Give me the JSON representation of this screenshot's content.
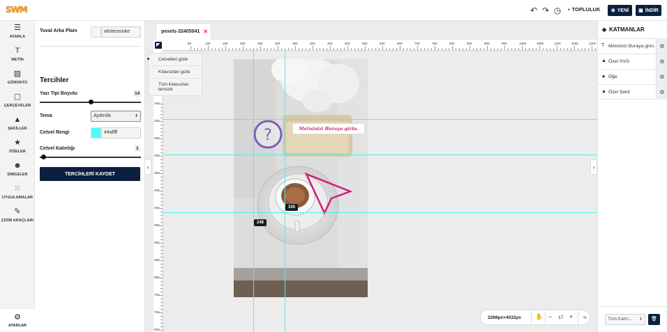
{
  "app": {
    "logo": "SWM"
  },
  "topbar": {
    "community_label": "TOPLULUK",
    "new_label": "YENİ",
    "download_label": "İNDİR"
  },
  "sidebar": {
    "items": [
      {
        "label": "AYARLA",
        "icon": "sliders-icon"
      },
      {
        "label": "METİN",
        "icon": "text-icon"
      },
      {
        "label": "GÖRÜNTÜ",
        "icon": "image-icon"
      },
      {
        "label": "ÇERÇEVELER",
        "icon": "frame-icon"
      },
      {
        "label": "ŞEKİLLER",
        "icon": "shapes-icon"
      },
      {
        "label": "ÖĞELER",
        "icon": "star-icon"
      },
      {
        "label": "SİMGELER",
        "icon": "emoji-icon"
      },
      {
        "label": "UYGULAMALAR",
        "icon": "grid-icon"
      },
      {
        "label": "ÇİZİM ARAÇLARI",
        "icon": "brush-icon"
      }
    ],
    "settings_label": "AYARLAR"
  },
  "settings": {
    "canvas_bg_label": "Tuval Arka Planı",
    "canvas_bg_value": "whitesmoke",
    "prefs_title": "Tercihler",
    "font_size_label": "Yazı Tipi Boyutu",
    "font_size_value": "14",
    "font_size_fraction": 0.5,
    "theme_label": "Tema",
    "theme_value": "Aydınlık",
    "ruler_color_label": "Cetvel Rengi",
    "ruler_color_value": "#4affff",
    "ruler_width_label": "Cetvel Kalınlığı",
    "ruler_width_value": "1",
    "ruler_width_fraction": 0.0,
    "save_label": "TERCİHLERİ KAYDET"
  },
  "workspace": {
    "tab_name": "pexels-32405041",
    "ruler_h_ticks": [
      "50",
      "100",
      "150",
      "200",
      "250",
      "300",
      "350",
      "400",
      "450",
      "500",
      "550",
      "600",
      "650",
      "700",
      "750",
      "800",
      "850",
      "900",
      "950",
      "1000",
      "1050",
      "1100",
      "1150",
      "1200"
    ],
    "ruler_v_ticks": [
      "150",
      "200",
      "250",
      "300",
      "350",
      "400",
      "450",
      "500",
      "550",
      "600",
      "650",
      "700",
      "750",
      "800"
    ],
    "context_menu": [
      "Cetvelleri gizle",
      "Kılavuzları gizle",
      "Tüm kılavuzları temizle"
    ],
    "canvas_text": "Metninizi Buraya girin.",
    "guide_tooltip_1": "335",
    "guide_tooltip_2": "248",
    "dimensions": "2268px×4032px",
    "zoom_value": "17",
    "zoom_unit": "%"
  },
  "layers": {
    "title": "KATMANLAR",
    "items": [
      {
        "name": "Metninizi Buraya girin.",
        "icon": "text-icon"
      },
      {
        "name": "Özel SVG",
        "icon": "shapes-icon"
      },
      {
        "name": "Öğe",
        "icon": "star-icon"
      },
      {
        "name": "Özel Şekil",
        "icon": "shapes-icon"
      }
    ],
    "filter_value": "Tüm Katm..."
  }
}
